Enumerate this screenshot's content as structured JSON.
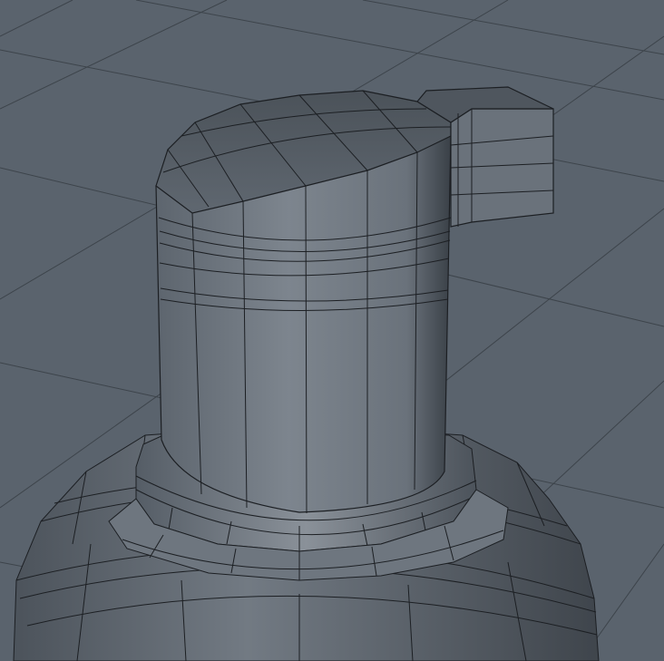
{
  "viewport": {
    "background": "#5a636d",
    "grid_color": "#3d444b",
    "mesh_face_color": "#737b84",
    "mesh_dark_color": "#4a5159",
    "wire_color": "#1c1f23"
  },
  "scene": {
    "object": "pump-bottle-mesh",
    "display_mode": "shaded-wireframe",
    "grid": true
  }
}
